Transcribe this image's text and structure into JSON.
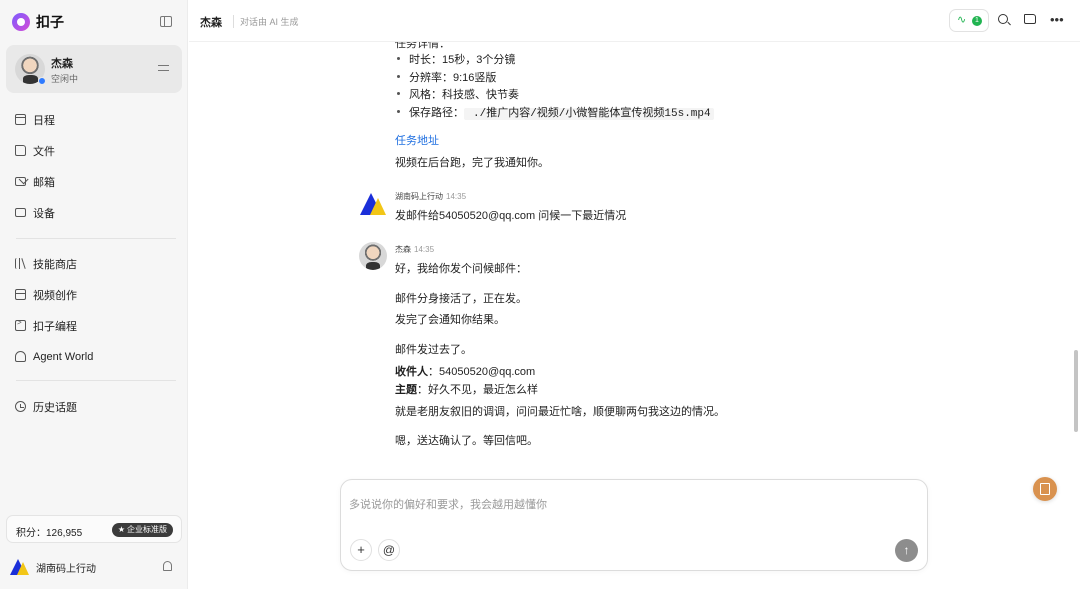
{
  "app": {
    "name": "扣子"
  },
  "profile": {
    "name": "杰森",
    "status": "空闲中"
  },
  "nav": [
    {
      "label": "日程",
      "icon": "calendar-icon"
    },
    {
      "label": "文件",
      "icon": "folder-icon"
    },
    {
      "label": "邮箱",
      "icon": "mail-icon"
    },
    {
      "label": "设备",
      "icon": "device-icon"
    },
    {
      "label": "技能商店",
      "icon": "books-icon"
    },
    {
      "label": "视频创作",
      "icon": "video-icon"
    },
    {
      "label": "扣子编程",
      "icon": "code-icon"
    },
    {
      "label": "Agent World",
      "icon": "world-icon"
    },
    {
      "label": "历史话题",
      "icon": "history-icon"
    }
  ],
  "points": {
    "text": "积分：126,955",
    "tier": "企业标准版"
  },
  "org": {
    "name": "湖南码上行动"
  },
  "header": {
    "title": "杰森",
    "subtitle": "对话由 AI 生成",
    "activity_count": "1"
  },
  "messages": {
    "cut_heading": "任务详情：",
    "bullets": [
      "时长：15秒，3个分镜",
      "分辨率：9:16竖版",
      "风格：科技感、快节奏"
    ],
    "save_path_label": "保存路径：",
    "save_path": "./推广内容/视频/小微智能体宣传视频15s.mp4",
    "task_link": "任务地址",
    "video_note": "视频在后台跑，完了我通知你。",
    "user_msg": {
      "sender": "湖南码上行动",
      "time": "14:35",
      "text": "发邮件给54050520@qq.com 问候一下最近情况"
    },
    "reply": {
      "sender": "杰森",
      "time": "14:35",
      "lines": [
        "好，我给你发个问候邮件：",
        "邮件分身接活了，正在发。",
        "发完了会通知你结果。",
        "邮件发过去了。"
      ],
      "recipient_label": "收件人",
      "recipient": "：54050520@qq.com",
      "subject_label": "主题",
      "subject": "：好久不见，最近怎么样",
      "body": "就是老朋友叙旧的调调，问问最近忙啥，顺便聊两句我这边的情况。",
      "closing": "嗯，送达确认了。等回信吧。"
    }
  },
  "composer": {
    "placeholder": "多说说你的偏好和要求，我会越用越懂你"
  }
}
